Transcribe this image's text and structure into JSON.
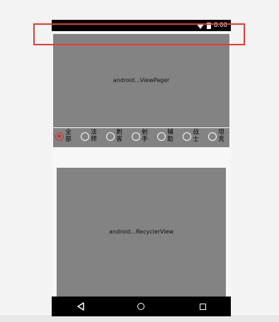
{
  "status_bar": {
    "time": "8:00",
    "wifi_icon": "wifi-icon",
    "battery_icon": "battery-icon"
  },
  "view_pager": {
    "label": "android...ViewPager"
  },
  "tabs": [
    {
      "label": "全部",
      "checked": true
    },
    {
      "label": "法师",
      "checked": false
    },
    {
      "label": "刺客",
      "checked": false
    },
    {
      "label": "射手",
      "checked": false
    },
    {
      "label": "辅助",
      "checked": false
    },
    {
      "label": "战士",
      "checked": false
    },
    {
      "label": "坦克",
      "checked": false
    }
  ],
  "recycler_view": {
    "label": "android...RecyclerView"
  },
  "nav_bar": {
    "back_icon": "back-icon",
    "home_icon": "home-icon",
    "recents_icon": "recents-icon"
  },
  "colors": {
    "highlight": "#e53935",
    "radio_checked": "#d32f2f",
    "placeholder_gray": "#838383"
  }
}
